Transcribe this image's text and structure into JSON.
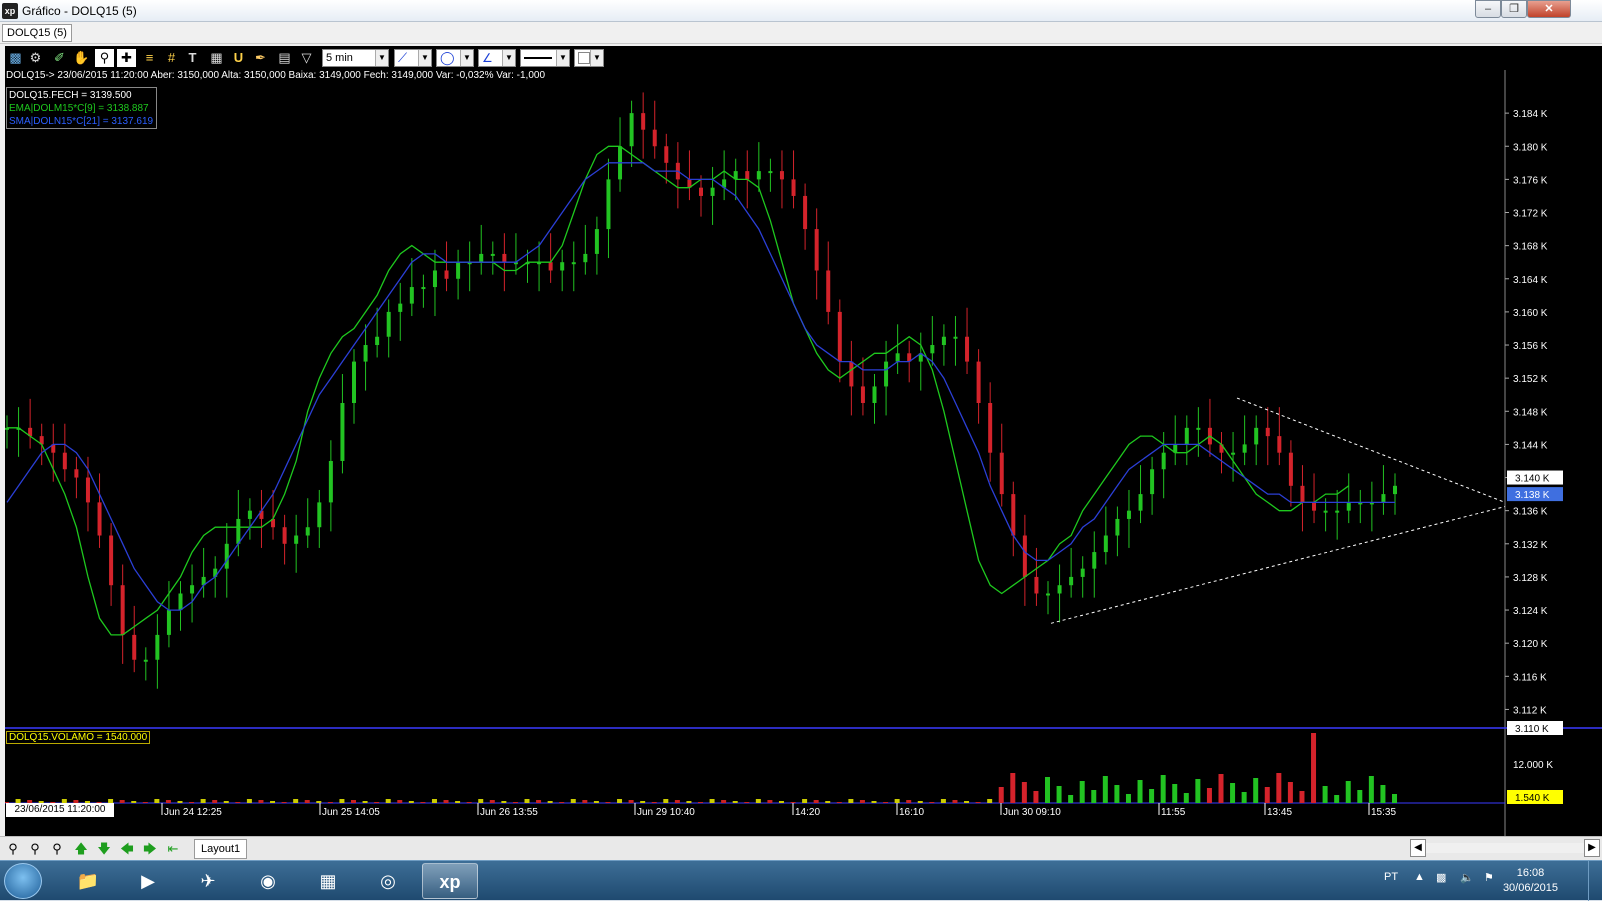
{
  "window": {
    "title": "Gráfico - DOLQ15 (5)",
    "app_icon": "xp",
    "controls": [
      "minimize-icon",
      "restore-icon",
      "close-icon"
    ]
  },
  "tab": {
    "label": "DOLQ15 (5)"
  },
  "toolbar": {
    "icons": [
      "chart-icon",
      "gear-icon",
      "pencil-icon",
      "hand-icon",
      "zoom-icon",
      "crosshair-icon",
      "hlines-icon",
      "grid-icon",
      "text-icon",
      "calculator-icon",
      "magnet-icon",
      "brush-icon",
      "clipboard-icon",
      "filter-icon"
    ],
    "period": "5 min",
    "line_tool": "line-icon",
    "shape_tool": "ellipse-icon",
    "fib_tool": "fan-icon",
    "line_style": "solid",
    "color_box": "white"
  },
  "chart_info": "DOLQ15-> 23/06/2015 11:20:00 Aber: 3150,000 Alta: 3150,000 Baixa: 3149,000 Fech: 3149,000 Var: -0,032% Var: -1,000",
  "legend": {
    "close": "DOLQ15.FECH = 3139.500",
    "ema": "EMA|DOLM15*C[9] = 3138.887",
    "sma": "SMA|DOLN15*C[21] = 3137.619"
  },
  "volume_legend": "DOLQ15.VOLAMO = 1540.000",
  "cursor_time": "23/06/2015 11:20:00",
  "price_axis": {
    "ticks": [
      "3.184 K",
      "3.180 K",
      "3.176 K",
      "3.172 K",
      "3.168 K",
      "3.164 K",
      "3.160 K",
      "3.156 K",
      "3.152 K",
      "3.148 K",
      "3.144 K",
      "3.140 K",
      "3.136 K",
      "3.132 K",
      "3.128 K",
      "3.124 K",
      "3.120 K",
      "3.116 K",
      "3.112 K"
    ],
    "last_price_label": "3.140 K",
    "avg_label": "3.138 K",
    "bottom_label": "3.110 K"
  },
  "volume_axis": {
    "ticks": [
      "12.000 K"
    ],
    "last_label": "1.540 K"
  },
  "time_axis": [
    "Jun 24 12:25",
    "Jun 25 14:05",
    "Jun 26 13:55",
    "Jun 29 10:40",
    "14:20",
    "16:10",
    "Jun 30 09:10",
    "11:55",
    "13:45",
    "15:35"
  ],
  "colors": {
    "background": "#000000",
    "up": "#22c322",
    "down": "#d4232b",
    "ema": "#1ec81e",
    "sma": "#2b3fd6",
    "trendline": "#ffffff",
    "legend_text": "#ffffff",
    "volume_text": "#ffff00",
    "avg_label_bg": "#3f6fe0"
  },
  "chart_data": {
    "type": "candlestick",
    "symbol": "DOLQ15",
    "interval": "5 min",
    "y_range": [
      3110,
      3188
    ],
    "close_series": [
      3146,
      3146,
      3145,
      3144,
      3143,
      3141,
      3140,
      3137,
      3133,
      3127,
      3121,
      3118,
      3118,
      3121,
      3124,
      3126,
      3127,
      3128,
      3129,
      3132,
      3135,
      3136,
      3135,
      3134,
      3132,
      3133,
      3134,
      3137,
      3142,
      3149,
      3154,
      3156,
      3157,
      3160,
      3161,
      3163,
      3163,
      3165,
      3164,
      3166,
      3166,
      3167,
      3167,
      3166,
      3166,
      3166,
      3166,
      3165,
      3166,
      3166,
      3167,
      3170,
      3176,
      3180,
      3184,
      3182,
      3180,
      3178,
      3176,
      3175,
      3174,
      3175,
      3176,
      3177,
      3176,
      3177,
      3177,
      3176,
      3174,
      3170,
      3165,
      3160,
      3154,
      3151,
      3149,
      3151,
      3154,
      3155,
      3154,
      3155,
      3156,
      3157,
      3157,
      3154,
      3149,
      3143,
      3138,
      3133,
      3128,
      3126,
      3126,
      3127,
      3128,
      3129,
      3131,
      3133,
      3135,
      3136,
      3138,
      3141,
      3143,
      3144,
      3146,
      3146,
      3144,
      3143,
      3143,
      3144,
      3146,
      3145,
      3143,
      3139,
      3137,
      3136,
      3136,
      3136,
      3137,
      3137,
      3137,
      3138,
      3139
    ],
    "series": [
      {
        "name": "EMA|DOLM15*C[9]",
        "last": 3138.887,
        "values": [
          3146,
          3146,
          3145,
          3144,
          3141,
          3138,
          3134,
          3128,
          3123,
          3121,
          3121,
          3122,
          3123,
          3124,
          3126,
          3128,
          3131,
          3133,
          3134,
          3134,
          3134,
          3134,
          3134,
          3135,
          3138,
          3142,
          3148,
          3152,
          3155,
          3157,
          3158,
          3160,
          3162,
          3165,
          3167,
          3168,
          3167,
          3166,
          3166,
          3166,
          3166,
          3166,
          3166,
          3165,
          3165,
          3166,
          3166,
          3166,
          3168,
          3172,
          3176,
          3179,
          3180,
          3180,
          3179,
          3178,
          3177,
          3176,
          3175,
          3175,
          3176,
          3176,
          3177,
          3176,
          3176,
          3175,
          3171,
          3166,
          3161,
          3158,
          3155,
          3153,
          3152,
          3153,
          3154,
          3155,
          3155,
          3156,
          3157,
          3156,
          3153,
          3148,
          3142,
          3136,
          3130,
          3127,
          3126,
          3127,
          3128,
          3129,
          3130,
          3132,
          3133,
          3136,
          3138,
          3140,
          3142,
          3144,
          3145,
          3145,
          3144,
          3143,
          3143,
          3144,
          3145,
          3144,
          3142,
          3140,
          3138,
          3137,
          3136,
          3136,
          3137,
          3137,
          3138,
          3138,
          3139
        ]
      },
      {
        "name": "SMA|DOLN15*C[21]",
        "last": 3137.619,
        "values": [
          3137,
          3139,
          3141,
          3143,
          3144,
          3144,
          3143,
          3141,
          3138,
          3135,
          3132,
          3129,
          3127,
          3125,
          3124,
          3124,
          3125,
          3127,
          3128,
          3130,
          3132,
          3134,
          3136,
          3138,
          3141,
          3144,
          3147,
          3150,
          3152,
          3154,
          3156,
          3158,
          3160,
          3162,
          3164,
          3166,
          3167,
          3167,
          3166,
          3166,
          3166,
          3166,
          3166,
          3166,
          3166,
          3167,
          3168,
          3170,
          3172,
          3174,
          3176,
          3177,
          3178,
          3178,
          3178,
          3178,
          3177,
          3177,
          3177,
          3176,
          3176,
          3176,
          3175,
          3174,
          3172,
          3170,
          3167,
          3164,
          3161,
          3158,
          3156,
          3155,
          3154,
          3154,
          3153,
          3153,
          3153,
          3154,
          3154,
          3155,
          3154,
          3152,
          3149,
          3146,
          3143,
          3139,
          3136,
          3133,
          3131,
          3130,
          3130,
          3131,
          3132,
          3134,
          3135,
          3137,
          3139,
          3141,
          3142,
          3143,
          3144,
          3144,
          3144,
          3144,
          3143,
          3142,
          3141,
          3140,
          3139,
          3138,
          3138,
          3137,
          3137,
          3137,
          3137,
          3137,
          3137,
          3137,
          3137,
          3137,
          3137
        ]
      }
    ],
    "trendlines": [
      {
        "from": [
          "Jun 30 09:10",
          3122.4
        ],
        "to": [
          "end",
          3136.5
        ]
      },
      {
        "from": [
          "Jun 30 13:25",
          3149.6
        ],
        "to": [
          "end",
          3137.0
        ]
      }
    ],
    "volume": {
      "last": 1540,
      "max_label": 12000
    }
  }
}
